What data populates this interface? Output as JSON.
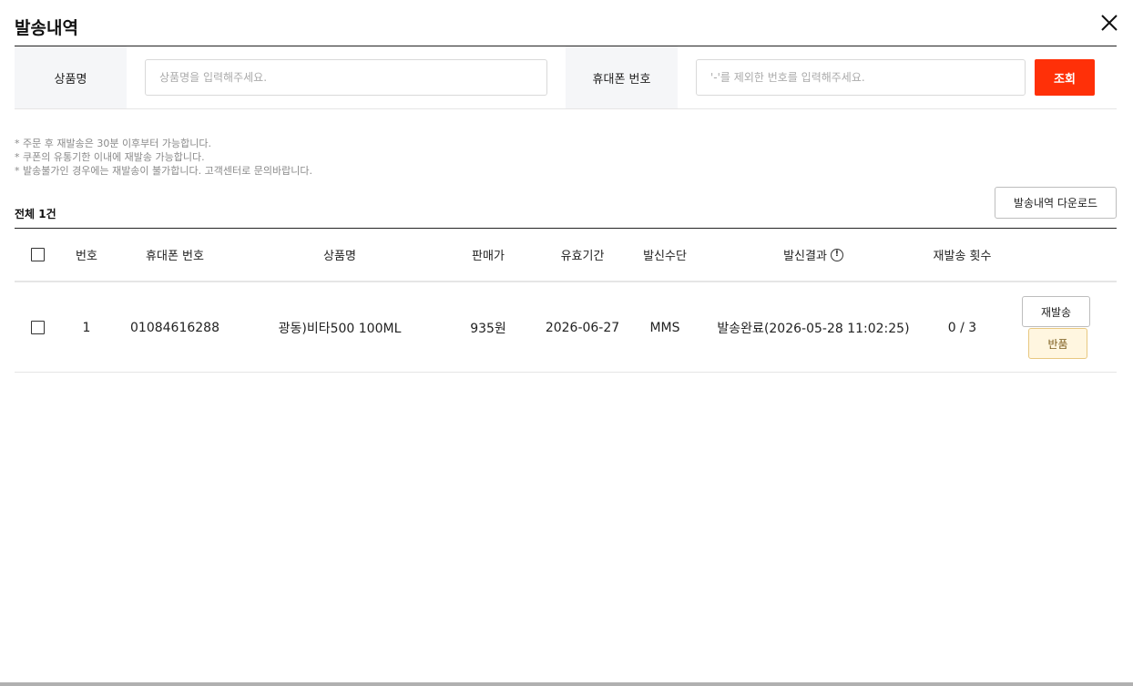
{
  "dialog": {
    "title": "발송내역"
  },
  "search": {
    "product_label": "상품명",
    "product_placeholder": "상품명을 입력해주세요.",
    "phone_label": "휴대폰 번호",
    "phone_placeholder": "'-'를 제외한 번호를 입력해주세요.",
    "search_button": "조회"
  },
  "notes": [
    "* 주문 후 재발송은 30분 이후부터 가능합니다.",
    "* 쿠폰의 유통기한 이내에 재발송 가능합니다.",
    "* 발송불가인 경우에는 재발송이 불가합니다. 고객센터로 문의바랍니다."
  ],
  "list": {
    "total": "전체 1건",
    "download_button": "발송내역 다운로드"
  },
  "table": {
    "headers": {
      "no": "번호",
      "phone": "휴대폰 번호",
      "product": "상품명",
      "price": "판매가",
      "expiry": "유효기간",
      "method": "발신수단",
      "result": "발신결과",
      "resend_count": "재발송 횟수"
    },
    "rows": [
      {
        "no": "1",
        "phone": "01084616288",
        "product": "광동)비타500 100ML",
        "price": "935원",
        "expiry": "2026-06-27",
        "method": "MMS",
        "result": "발송완료(2026-05-28 11:02:25)",
        "resend_count": "0 / 3",
        "resend_button": "재발송",
        "return_button": "반품"
      }
    ]
  },
  "colors": {
    "accent": "#ff3008",
    "return_bg": "#fff6e0"
  },
  "icons": [
    "close-icon",
    "info-icon"
  ]
}
